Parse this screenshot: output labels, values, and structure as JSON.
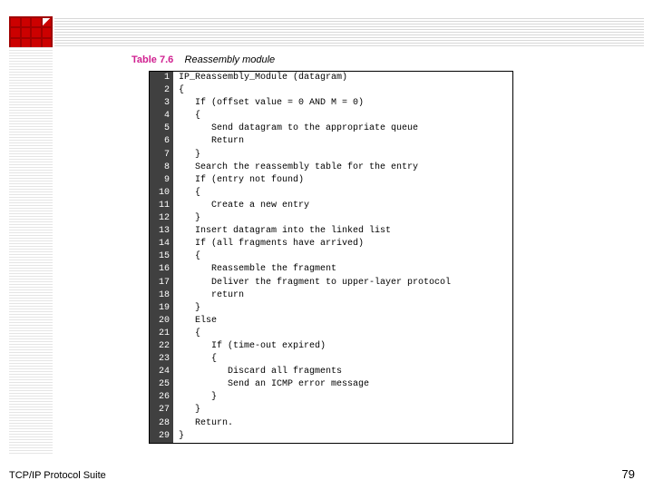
{
  "header": {
    "logo_name": "grid-logo"
  },
  "caption": {
    "label": "Table 7.6",
    "title": "Reassembly module"
  },
  "code": {
    "lines": [
      {
        "n": "1",
        "indent": 0,
        "text": "IP_Reassembly_Module (datagram)"
      },
      {
        "n": "2",
        "indent": 0,
        "text": "{"
      },
      {
        "n": "3",
        "indent": 1,
        "text": "If (offset value = 0 AND M = 0)"
      },
      {
        "n": "4",
        "indent": 1,
        "text": "{"
      },
      {
        "n": "5",
        "indent": 2,
        "text": "Send datagram to the appropriate queue"
      },
      {
        "n": "6",
        "indent": 2,
        "text": "Return"
      },
      {
        "n": "7",
        "indent": 1,
        "text": "}"
      },
      {
        "n": "8",
        "indent": 1,
        "text": "Search the reassembly table for the entry"
      },
      {
        "n": "9",
        "indent": 1,
        "text": "If (entry not found)"
      },
      {
        "n": "10",
        "indent": 1,
        "text": "{"
      },
      {
        "n": "11",
        "indent": 2,
        "text": "Create a new entry"
      },
      {
        "n": "12",
        "indent": 1,
        "text": "}"
      },
      {
        "n": "13",
        "indent": 1,
        "text": "Insert datagram into the linked list"
      },
      {
        "n": "14",
        "indent": 1,
        "text": "If (all fragments have arrived)"
      },
      {
        "n": "15",
        "indent": 1,
        "text": "{"
      },
      {
        "n": "16",
        "indent": 2,
        "text": "Reassemble the fragment"
      },
      {
        "n": "17",
        "indent": 2,
        "text": "Deliver the fragment to upper-layer protocol"
      },
      {
        "n": "18",
        "indent": 2,
        "text": "return"
      },
      {
        "n": "19",
        "indent": 1,
        "text": "}"
      },
      {
        "n": "20",
        "indent": 1,
        "text": "Else"
      },
      {
        "n": "21",
        "indent": 1,
        "text": "{"
      },
      {
        "n": "22",
        "indent": 2,
        "text": "If (time-out expired)"
      },
      {
        "n": "23",
        "indent": 2,
        "text": "{"
      },
      {
        "n": "24",
        "indent": 3,
        "text": "Discard all fragments"
      },
      {
        "n": "25",
        "indent": 3,
        "text": "Send an ICMP error message"
      },
      {
        "n": "26",
        "indent": 2,
        "text": "}"
      },
      {
        "n": "27",
        "indent": 1,
        "text": "}"
      },
      {
        "n": "28",
        "indent": 1,
        "text": "Return."
      },
      {
        "n": "29",
        "indent": 0,
        "text": "}"
      }
    ]
  },
  "footer": {
    "left": "TCP/IP Protocol Suite",
    "right": "79"
  }
}
